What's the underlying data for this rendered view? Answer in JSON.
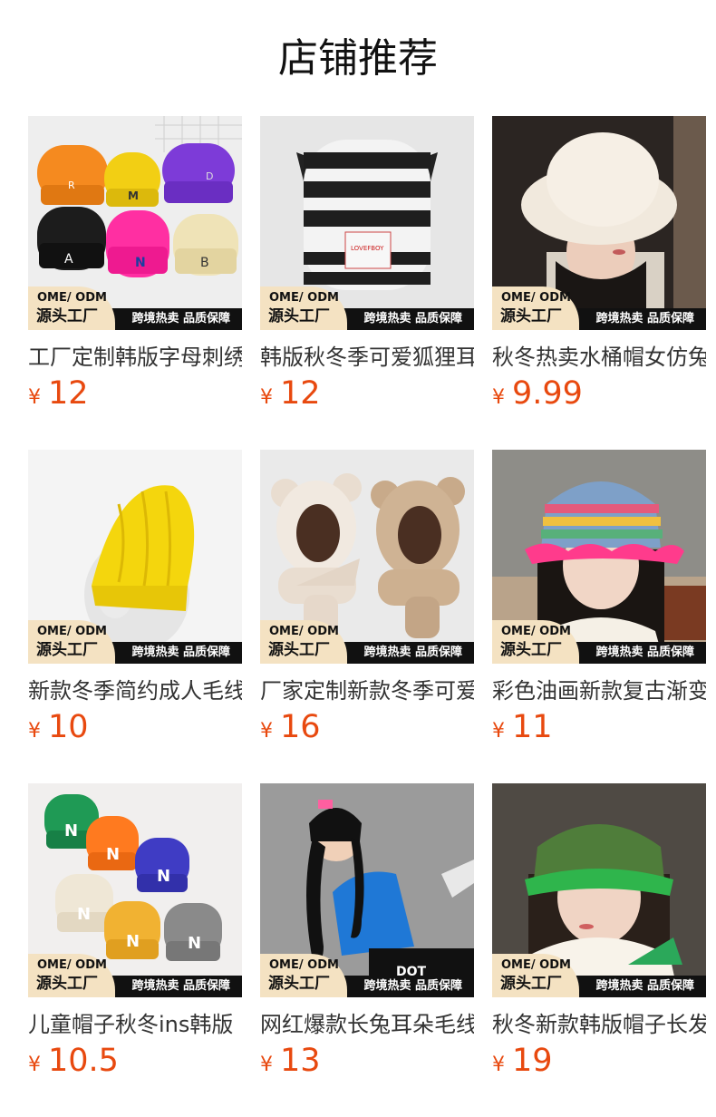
{
  "page": {
    "title": "店铺推荐"
  },
  "badge": {
    "ome": "OME/ ODM",
    "factory": "源头工厂",
    "slogan": "跨境热卖 品质保障"
  },
  "products": [
    {
      "name": "工厂定制韩版字母刺绣",
      "currency": "¥",
      "price": "12"
    },
    {
      "name": "韩版秋冬季可爱狐狸耳",
      "currency": "¥",
      "price": "12"
    },
    {
      "name": "秋冬热卖水桶帽女仿兔",
      "currency": "¥",
      "price": "9.99"
    },
    {
      "name": "新款冬季简约成人毛线",
      "currency": "¥",
      "price": "10"
    },
    {
      "name": "厂家定制新款冬季可爱",
      "currency": "¥",
      "price": "16"
    },
    {
      "name": "彩色油画新款复古渐变",
      "currency": "¥",
      "price": "11"
    },
    {
      "name": "儿童帽子秋冬ins韩版",
      "currency": "¥",
      "price": "10.5"
    },
    {
      "name": "网红爆款长兔耳朵毛线",
      "currency": "¥",
      "price": "13"
    },
    {
      "name": "秋冬新款韩版帽子长发",
      "currency": "¥",
      "price": "19"
    }
  ],
  "image_labels": {
    "hat1_letters": [
      "A",
      "N",
      "B",
      "M",
      "D",
      "R"
    ],
    "hat2_tag": "LOVEFBOY",
    "hat8_text": "DOT"
  },
  "colors": {
    "price": "#e8490f",
    "badge_black": "#111111",
    "badge_cream": "#f4e2c2"
  }
}
